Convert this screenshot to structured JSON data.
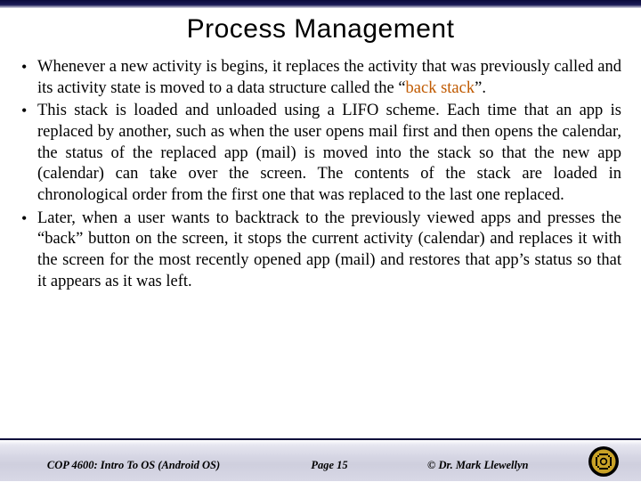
{
  "title": "Process Management",
  "bullets": {
    "b1_pre": "Whenever a new activity is begins, it replaces the activity that was previously called and its activity state is moved to a data structure called the “",
    "b1_hl": "back stack",
    "b1_post": "”.",
    "b2": "This stack is loaded and unloaded using a LIFO scheme.  Each time that an app is replaced by another, such as when the user opens mail first and then opens the calendar, the status of the replaced app (mail) is moved into the stack so that the new app (calendar) can take over the screen.  The contents of the stack are loaded in chronological order from the first one that was replaced to the last one replaced.",
    "b3": "Later, when a user wants to backtrack to the previously viewed apps and presses the “back” button on the screen, it stops the current activity (calendar) and replaces it with the screen for the most recently opened app (mail) and restores that app’s status so that it appears as it was left."
  },
  "footer": {
    "course": "COP 4600: Intro To OS  (Android OS)",
    "page": "Page 15",
    "author": "© Dr. Mark Llewellyn"
  }
}
